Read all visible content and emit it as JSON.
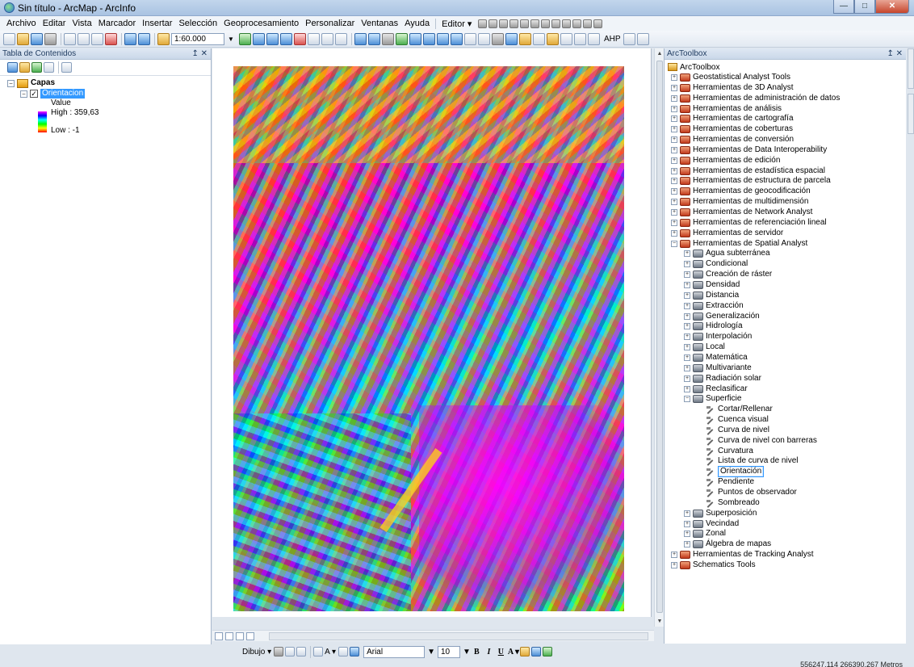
{
  "window": {
    "title": "Sin título - ArcMap - ArcInfo",
    "buttons": {
      "minimize": "—",
      "maximize": "□",
      "close": "✕"
    }
  },
  "menubar": {
    "items": [
      "Archivo",
      "Editar",
      "Vista",
      "Marcador",
      "Insertar",
      "Selección",
      "Geoprocesamiento",
      "Personalizar",
      "Ventanas",
      "Ayuda"
    ],
    "editor": "Editor ▾"
  },
  "toolbar": {
    "scale": "1:60.000",
    "ahp": "AHP"
  },
  "toc": {
    "title": "Tabla de Contenidos",
    "pin": "↥ ✕",
    "layers_label": "Capas",
    "layer_name": "Orientacion",
    "legend_field": "Value",
    "high": "High : 359,63",
    "low": "Low : -1",
    "expand_minus": "−",
    "check": "✓"
  },
  "map": {
    "coordinates": "556247.114  266390.267 Metros"
  },
  "drawbar": {
    "dibujo": "Dibujo ▾",
    "font": "Arial",
    "size": "10",
    "bold": "B",
    "italic": "I",
    "underline": "U",
    "text_a": "A ▾"
  },
  "toolbox": {
    "title": "ArcToolbox",
    "pin": "↥ ✕",
    "root": "ArcToolbox",
    "toolsets": [
      "Geostatistical Analyst Tools",
      "Herramientas de 3D Analyst",
      "Herramientas de administración de datos",
      "Herramientas de análisis",
      "Herramientas de cartografía",
      "Herramientas de coberturas",
      "Herramientas de conversión",
      "Herramientas de Data Interoperability",
      "Herramientas de edición",
      "Herramientas de estadística espacial",
      "Herramientas de estructura de parcela",
      "Herramientas de geocodificación",
      "Herramientas de multidimensión",
      "Herramientas de Network Analyst",
      "Herramientas de referenciación lineal",
      "Herramientas de servidor",
      "Herramientas de Spatial Analyst"
    ],
    "spatial_analyst": [
      "Agua subterránea",
      "Condicional",
      "Creación de ráster",
      "Densidad",
      "Distancia",
      "Extracción",
      "Generalización",
      "Hidrología",
      "Interpolación",
      "Local",
      "Matemática",
      "Multivariante",
      "Radiación solar",
      "Reclasificar",
      "Superficie"
    ],
    "superficie_tools": [
      "Cortar/Rellenar",
      "Cuenca visual",
      "Curva de nivel",
      "Curva de nivel con barreras",
      "Curvatura",
      "Lista de curva de nivel",
      "Orientación",
      "Pendiente",
      "Puntos de observador",
      "Sombreado"
    ],
    "after_superficie": [
      "Superposición",
      "Vecindad",
      "Zonal",
      "Álgebra de mapas"
    ],
    "tail": [
      "Herramientas de Tracking Analyst",
      "Schematics Tools"
    ],
    "plus": "+",
    "minus": "−"
  }
}
